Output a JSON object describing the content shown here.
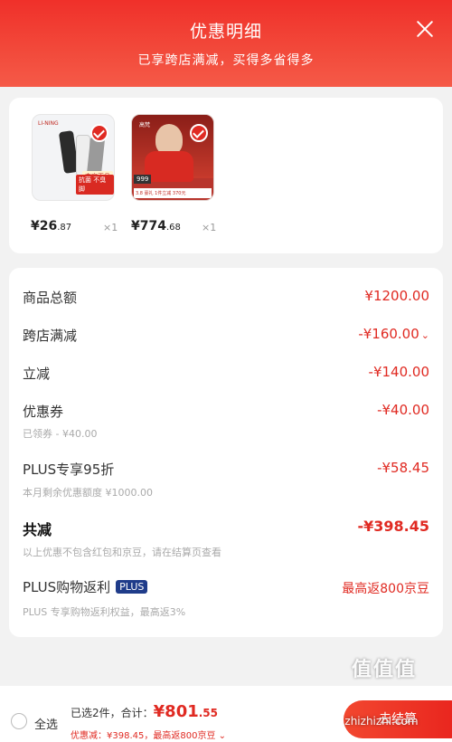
{
  "header": {
    "title": "优惠明细",
    "subtitle": "已享跨店满减，买得多省得多"
  },
  "products": [
    {
      "price_main": "¥26",
      "price_dec": ".87",
      "qty": "×1",
      "brand": "LI-NING",
      "label_a": "李宁正品",
      "label_b": "抗菌 不臭脚"
    },
    {
      "price_main": "¥774",
      "price_dec": ".68",
      "qty": "×1",
      "brand": "高梵",
      "label_a": "999",
      "label_b": "3.8 豪礼 1件立减 370元"
    }
  ],
  "details": {
    "total_label": "商品总额",
    "total_value": "¥1200.00",
    "cross_label": "跨店满减",
    "cross_value": "-¥160.00",
    "direct_label": "立减",
    "direct_value": "-¥140.00",
    "coupon_label": "优惠券",
    "coupon_value": "-¥40.00",
    "coupon_sub": "已领券 - ¥40.00",
    "plus_label": "PLUS专享95折",
    "plus_value": "-¥58.45",
    "plus_sub": "本月剩余优惠额度 ¥1000.00",
    "sum_label": "共减",
    "sum_value": "-¥398.45",
    "sum_sub": "以上优惠不包含红包和京豆，请在结算页查看",
    "rebate_label": "PLUS购物返利",
    "rebate_badge": "PLUS",
    "rebate_value": "最高返800京豆",
    "rebate_sub": "PLUS 专享购物返利权益，最高返3%"
  },
  "footer": {
    "select_all": "全选",
    "summary_prefix": "已选2件，合计：",
    "total_main": "¥801",
    "total_dec": ".55",
    "discount_line": "优惠减：¥398.45，最高返800京豆",
    "checkout": "去结算"
  },
  "watermark": {
    "main": "值值值",
    "sub": "zhizhizhi.com"
  },
  "colors": {
    "accent": "#e02a22",
    "header": "#f0302a"
  }
}
